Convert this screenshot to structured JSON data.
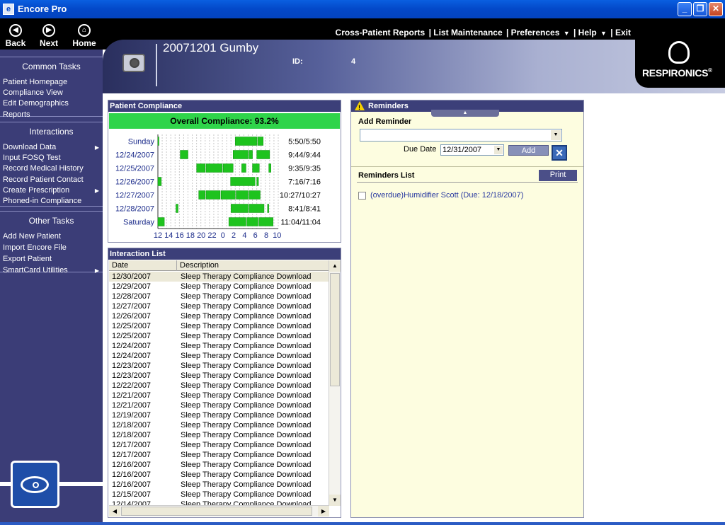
{
  "window": {
    "title": "Encore Pro",
    "app_icon": "e",
    "minimize": "_",
    "maximize": "❐",
    "close": "✕"
  },
  "nav": {
    "back": "Back",
    "next": "Next",
    "home": "Home"
  },
  "menu": {
    "items": [
      "Cross-Patient Reports",
      "| List Maintenance",
      "| Preferences",
      "| Help",
      "| Exit"
    ],
    "dropdown_arrow": "▼"
  },
  "sidebar": {
    "groups": [
      {
        "title": "Common Tasks",
        "items": [
          "Patient Homepage",
          "Compliance View",
          "Edit Demographics",
          "Reports"
        ]
      },
      {
        "title": "Interactions",
        "items": [
          "Download Data",
          "Input FOSQ Test",
          "Record Medical History",
          "Record Patient Contact",
          "Create Prescription",
          "Phoned-in Compliance"
        ]
      },
      {
        "title": "Other Tasks",
        "items": [
          "Add New Patient",
          "Import Encore File",
          "Export Patient",
          "SmartCard Utilities"
        ]
      }
    ],
    "submenu_arrow": "▶"
  },
  "header": {
    "patient_name": "20071201 Gumby",
    "id_label": "ID:",
    "id_value": "4",
    "logo": "RESPIRONICS",
    "logo_mark": "®"
  },
  "compliance": {
    "title": "Patient Compliance",
    "overall": "Overall Compliance: 93.2%"
  },
  "chart_data": {
    "type": "bar",
    "orientation": "horizontal-timeline",
    "categories": [
      "Sunday",
      "12/24/2007",
      "12/25/2007",
      "12/26/2007",
      "12/27/2007",
      "12/28/2007",
      "Saturday"
    ],
    "x_tick_labels": [
      "12",
      "14",
      "16",
      "18",
      "20",
      "22",
      "0",
      "2",
      "4",
      "6",
      "8",
      "10"
    ],
    "totals": [
      "5:50/5:50",
      "9:44/9:44",
      "9:35/9:35",
      "7:16/7:16",
      "10:27/10:27",
      "8:41/8:41",
      "11:04/11:04"
    ],
    "bar_color": "#1ec31e",
    "series": [
      {
        "name": "",
        "segments": [
          [
            12.0,
            12.2
          ],
          [
            30.0,
            35.0
          ],
          [
            35.2,
            36.5
          ]
        ]
      },
      {
        "name": "",
        "segments": [
          [
            17.2,
            19.0
          ],
          [
            29.5,
            33.0
          ],
          [
            33.2,
            34.0
          ],
          [
            35.0,
            38.0
          ]
        ]
      },
      {
        "name": "",
        "segments": [
          [
            21.0,
            23.0
          ],
          [
            23.2,
            27.0
          ],
          [
            27.2,
            29.5
          ],
          [
            31.5,
            32.5
          ],
          [
            34.0,
            35.6
          ],
          [
            37.8,
            38.3
          ]
        ]
      },
      {
        "name": "",
        "segments": [
          [
            12.0,
            12.8
          ],
          [
            28.9,
            34.6
          ],
          [
            35.0,
            35.4
          ]
        ]
      },
      {
        "name": "",
        "segments": [
          [
            21.5,
            23.0
          ],
          [
            23.2,
            26.5
          ],
          [
            26.7,
            30.0
          ],
          [
            30.2,
            33.0
          ],
          [
            33.2,
            35.8
          ]
        ]
      },
      {
        "name": "",
        "segments": [
          [
            16.2,
            16.7
          ],
          [
            29.0,
            33.0
          ],
          [
            33.2,
            36.7
          ],
          [
            37.5,
            37.8
          ]
        ]
      },
      {
        "name": "",
        "segments": [
          [
            12.0,
            13.5
          ],
          [
            28.5,
            32.5
          ],
          [
            32.7,
            35.3
          ],
          [
            35.5,
            38.8
          ]
        ]
      }
    ],
    "xlim": [
      12,
      40
    ]
  },
  "interactions": {
    "title": "Interaction List",
    "columns": [
      "Date",
      "Description"
    ],
    "rows": [
      [
        "12/30/2007",
        "Sleep Therapy Compliance Download"
      ],
      [
        "12/29/2007",
        "Sleep Therapy Compliance Download"
      ],
      [
        "12/28/2007",
        "Sleep Therapy Compliance Download"
      ],
      [
        "12/27/2007",
        "Sleep Therapy Compliance Download"
      ],
      [
        "12/26/2007",
        "Sleep Therapy Compliance Download"
      ],
      [
        "12/25/2007",
        "Sleep Therapy Compliance Download"
      ],
      [
        "12/25/2007",
        "Sleep Therapy Compliance Download"
      ],
      [
        "12/24/2007",
        "Sleep Therapy Compliance Download"
      ],
      [
        "12/24/2007",
        "Sleep Therapy Compliance Download"
      ],
      [
        "12/23/2007",
        "Sleep Therapy Compliance Download"
      ],
      [
        "12/23/2007",
        "Sleep Therapy Compliance Download"
      ],
      [
        "12/22/2007",
        "Sleep Therapy Compliance Download"
      ],
      [
        "12/21/2007",
        "Sleep Therapy Compliance Download"
      ],
      [
        "12/21/2007",
        "Sleep Therapy Compliance Download"
      ],
      [
        "12/19/2007",
        "Sleep Therapy Compliance Download"
      ],
      [
        "12/18/2007",
        "Sleep Therapy Compliance Download"
      ],
      [
        "12/18/2007",
        "Sleep Therapy Compliance Download"
      ],
      [
        "12/17/2007",
        "Sleep Therapy Compliance Download"
      ],
      [
        "12/17/2007",
        "Sleep Therapy Compliance Download"
      ],
      [
        "12/16/2007",
        "Sleep Therapy Compliance Download"
      ],
      [
        "12/16/2007",
        "Sleep Therapy Compliance Download"
      ],
      [
        "12/16/2007",
        "Sleep Therapy Compliance Download"
      ],
      [
        "12/15/2007",
        "Sleep Therapy Compliance Download"
      ],
      [
        "12/14/2007",
        "Sleep Therapy Compliance Download"
      ]
    ]
  },
  "reminders": {
    "title": "Reminders",
    "add_label": "Add Reminder",
    "due_label": "Due Date",
    "due_value": "12/31/2007",
    "add_button": "Add",
    "cancel_icon": "✕",
    "list_label": "Reminders List",
    "print_button": "Print",
    "items": [
      "(overdue)Humidifier Scott (Due: 12/18/2007)"
    ],
    "warning_glyph": "!"
  }
}
